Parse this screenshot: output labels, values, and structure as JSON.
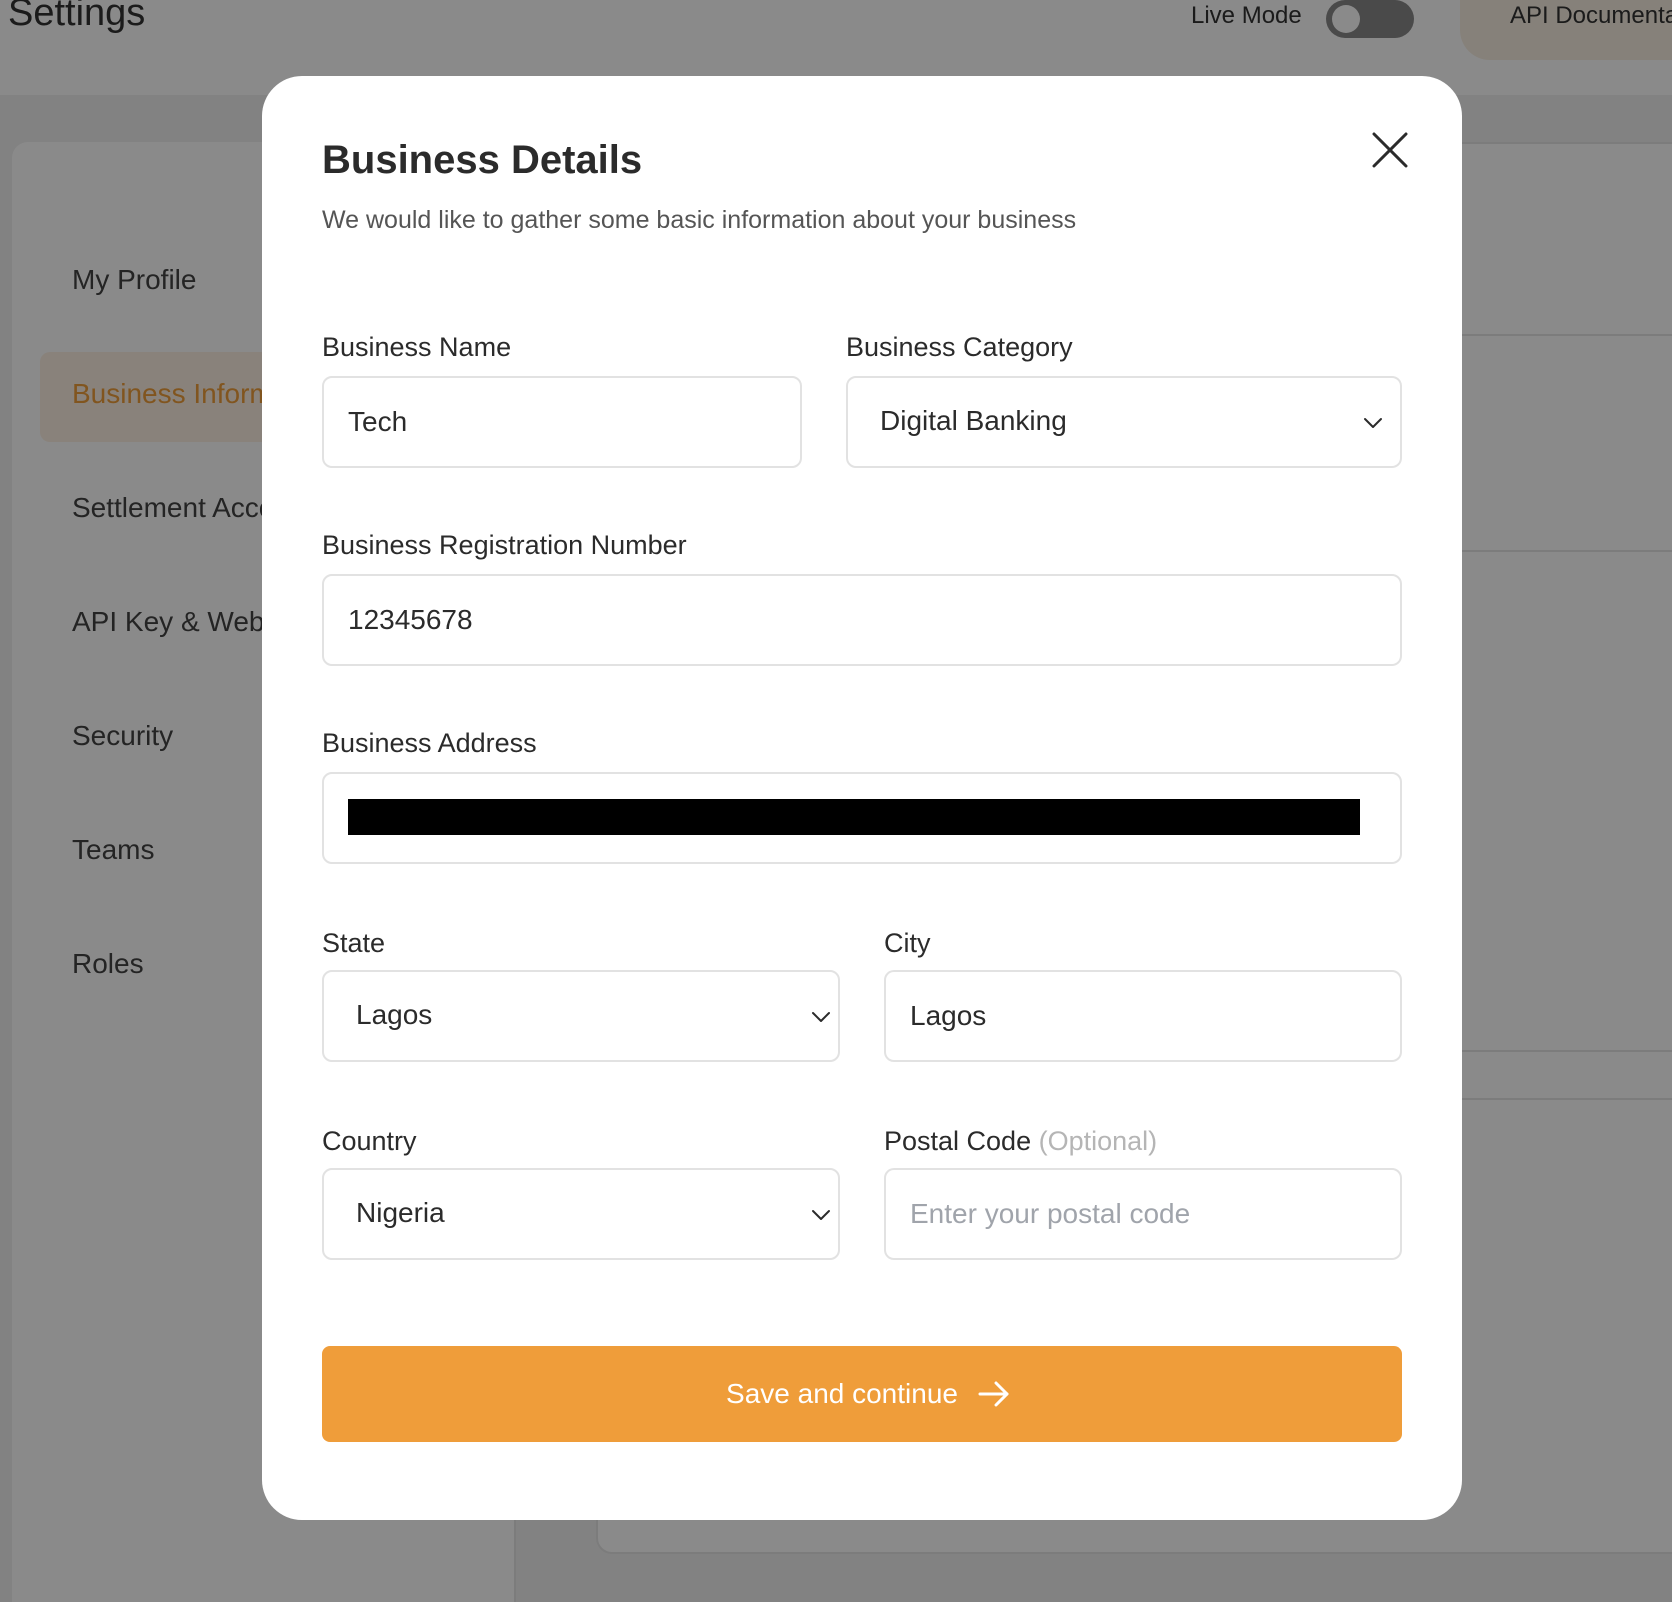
{
  "header": {
    "title": "Settings",
    "live_mode_label": "Live Mode",
    "live_mode_on": false,
    "api_docs_label": "API Documentation"
  },
  "sidebar": {
    "items": [
      {
        "label": "My Profile",
        "active": false
      },
      {
        "label": "Business Information",
        "active": true
      },
      {
        "label": "Settlement Account",
        "active": false
      },
      {
        "label": "API Key & Webhooks",
        "active": false
      },
      {
        "label": "Security",
        "active": false
      },
      {
        "label": "Teams",
        "active": false
      },
      {
        "label": "Roles",
        "active": false
      }
    ]
  },
  "modal": {
    "title": "Business Details",
    "subtitle": "We would like to gather some basic information about your business",
    "fields": {
      "business_name": {
        "label": "Business Name",
        "value": "Tech"
      },
      "business_category": {
        "label": "Business Category",
        "value": "Digital Banking"
      },
      "registration_number": {
        "label": "Business Registration Number",
        "value": "12345678"
      },
      "business_address": {
        "label": "Business Address",
        "value": ""
      },
      "state": {
        "label": "State",
        "value": "Lagos"
      },
      "city": {
        "label": "City",
        "value": "Lagos"
      },
      "country": {
        "label": "Country",
        "value": "Nigeria"
      },
      "postal_code": {
        "label": "Postal Code",
        "optional_label": "(Optional)",
        "value": "",
        "placeholder": "Enter your postal code"
      }
    },
    "submit_label": "Save and continue"
  },
  "colors": {
    "accent": "#ef9d3a",
    "overlay": "rgba(0,0,0,0.46)"
  },
  "icons": {
    "close": "close-icon",
    "chevron": "chevron-down-icon",
    "arrow": "arrow-right-icon"
  }
}
